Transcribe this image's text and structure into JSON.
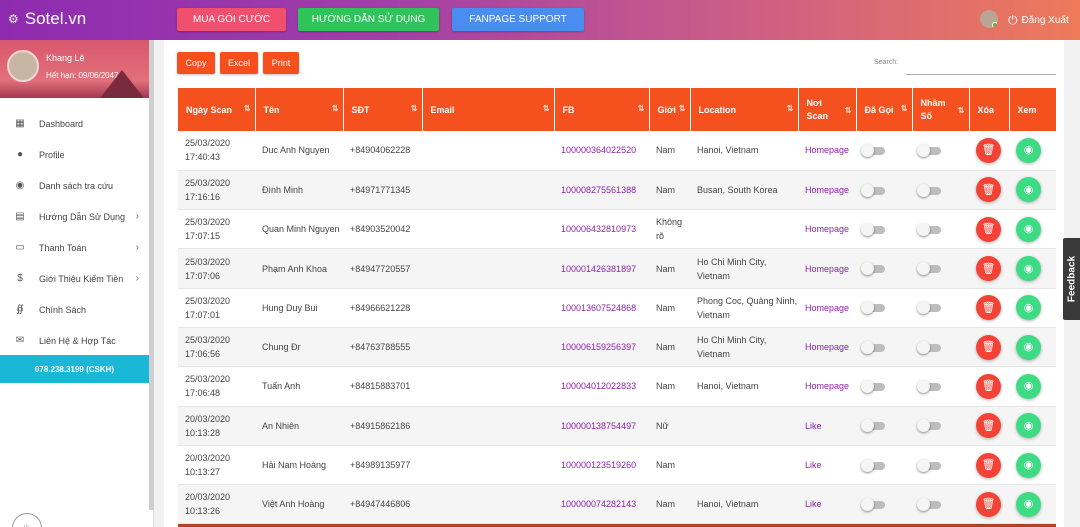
{
  "brand": {
    "name": "Sotel.vn"
  },
  "header": {
    "buttons": [
      "MUA GÓI CƯỚC",
      "HƯỚNG DẪN SỬ DỤNG",
      "FANPAGE SUPPORT"
    ],
    "logout": "Đăng Xuất",
    "colors": {
      "buy": "#f0506e",
      "guide": "#2fc45a",
      "fanpage": "#4a8df0"
    }
  },
  "profile": {
    "name": "Khang Lê",
    "expiry": "Hết hạn: 09/06/2047"
  },
  "sidebar": {
    "items": [
      {
        "label": "Dashboard",
        "icon": "dashboard-icon"
      },
      {
        "label": "Profile",
        "icon": "person-icon"
      },
      {
        "label": "Danh sách tra cứu",
        "icon": "eye-icon"
      },
      {
        "label": "Hướng Dẫn Sử Dụng",
        "icon": "message-icon"
      },
      {
        "label": "Thanh Toán",
        "icon": "card-icon"
      },
      {
        "label": "Giới Thiệu Kiếm Tiền",
        "icon": "dollar-icon"
      },
      {
        "label": "Chính Sách",
        "icon": "fingerprint-icon"
      },
      {
        "label": "Liên Hệ & Hợp Tác",
        "icon": "mail-icon"
      }
    ],
    "hotline": "078.238.3199 (CSKH)"
  },
  "toolbar": {
    "copy": "Copy",
    "excel": "Excel",
    "print": "Print",
    "search_label": "Search:"
  },
  "table": {
    "headers": [
      "Ngày Scan",
      "Tên",
      "SĐT",
      "Email",
      "FB",
      "Giới",
      "Location",
      "Nơi Scan",
      "Đã Gọi",
      "Nhầm Số",
      "Xóa",
      "Xem"
    ],
    "rows": [
      {
        "date": "25/03/2020",
        "time": "17:40:43",
        "name": "Duc Anh Nguyen",
        "phone": "+84904062228",
        "email": "",
        "fb": "100000364022520",
        "gender": "Nam",
        "location": "Hanoi, Vietnam",
        "source": "Homepage"
      },
      {
        "date": "25/03/2020",
        "time": "17:16:16",
        "name": "Đình Minh",
        "phone": "+84971771345",
        "email": "",
        "fb": "100008275561388",
        "gender": "Nam",
        "location": "Busan, South Korea",
        "source": "Homepage"
      },
      {
        "date": "25/03/2020",
        "time": "17:07:15",
        "name": "Quan Minh Nguyen",
        "phone": "+84903520042",
        "email": "",
        "fb": "100006432810973",
        "gender": "Không rõ",
        "location": "",
        "source": "Homepage"
      },
      {
        "date": "25/03/2020",
        "time": "17:07:06",
        "name": "Phạm Anh Khoa",
        "phone": "+84947720557",
        "email": "",
        "fb": "100001426381897",
        "gender": "Nam",
        "location": "Ho Chi Minh City, Vietnam",
        "source": "Homepage"
      },
      {
        "date": "25/03/2020",
        "time": "17:07:01",
        "name": "Hung Duy Bui",
        "phone": "+84966621228",
        "email": "",
        "fb": "100013607524868",
        "gender": "Nam",
        "location": "Phong Coc, Quảng Ninh, Vietnam",
        "source": "Homepage"
      },
      {
        "date": "25/03/2020",
        "time": "17:06:56",
        "name": "Chung Đr",
        "phone": "+84763788555",
        "email": "",
        "fb": "100006159256397",
        "gender": "Nam",
        "location": "Ho Chi Minh City, Vietnam",
        "source": "Homepage"
      },
      {
        "date": "25/03/2020",
        "time": "17:06:48",
        "name": "Tuấn Anh",
        "phone": "+84815883701",
        "email": "",
        "fb": "100004012022833",
        "gender": "Nam",
        "location": "Hanoi, Vietnam",
        "source": "Homepage"
      },
      {
        "date": "20/03/2020",
        "time": "10:13:28",
        "name": "An Nhiên",
        "phone": "+84915862186",
        "email": "",
        "fb": "100000138754497",
        "gender": "Nữ",
        "location": "",
        "source": "Like"
      },
      {
        "date": "20/03/2020",
        "time": "10:13:27",
        "name": "Hải Nam Hoàng",
        "phone": "+84989135977",
        "email": "",
        "fb": "100000123519260",
        "gender": "Nam",
        "location": "",
        "source": "Like"
      },
      {
        "date": "20/03/2020",
        "time": "10:13:26",
        "name": "Việt Anh Hoàng",
        "phone": "+84947446806",
        "email": "",
        "fb": "100000074282143",
        "gender": "Nam",
        "location": "Hanoi, Vietnam",
        "source": "Like"
      }
    ]
  },
  "feedback": "Feedback",
  "accent": "#f4511e"
}
